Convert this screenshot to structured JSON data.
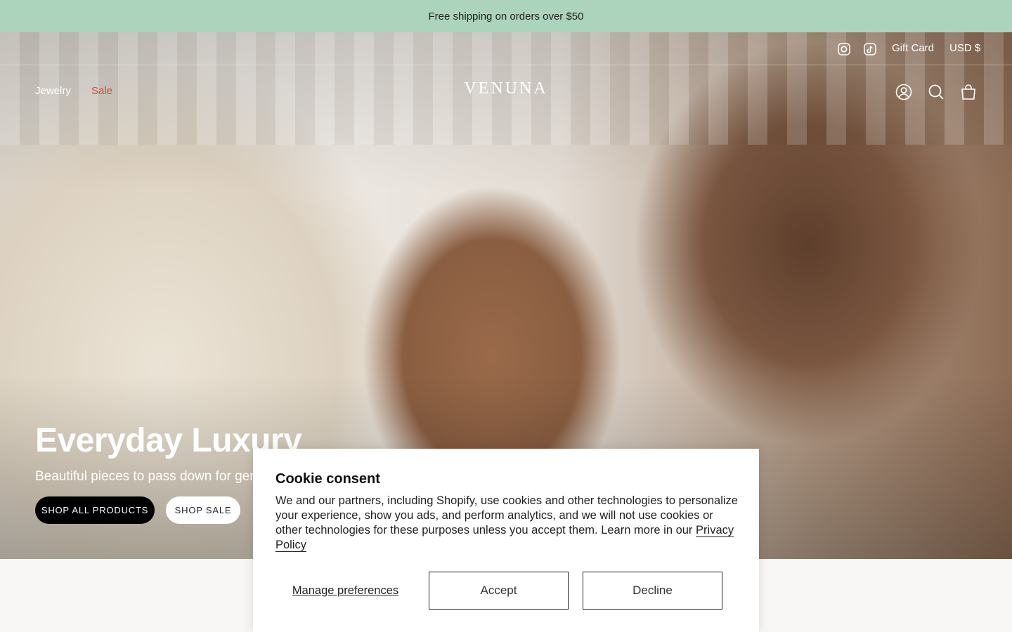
{
  "announcement": {
    "text": "Free shipping on orders over $50"
  },
  "utility": {
    "social": [
      {
        "icon": "instagram-icon"
      },
      {
        "icon": "tiktok-icon"
      }
    ],
    "gift_card": "Gift Card",
    "currency": "USD $"
  },
  "nav": {
    "items": [
      {
        "label": "Jewelry",
        "color": "#ffffff"
      },
      {
        "label": "Sale",
        "color": "#e0443a"
      }
    ]
  },
  "logo": {
    "text": "VENUNA"
  },
  "header_icons": [
    "account-icon",
    "search-icon",
    "cart-icon"
  ],
  "hero": {
    "title": "Everyday Luxury",
    "subtitle": "Beautiful pieces to pass down for gen",
    "primary_button": "SHOP ALL PRODUCTS",
    "secondary_button": "SHOP SALE"
  },
  "cookie": {
    "title": "Cookie consent",
    "body": "We and our partners, including Shopify, use cookies and other technologies to personalize your experience, show you ads, and perform analytics, and we will not use cookies or other technologies for these purposes unless you accept them. Learn more in our",
    "privacy_link": "Privacy Policy",
    "manage_label": "Manage preferences",
    "accept_label": "Accept",
    "decline_label": "Decline"
  },
  "colors": {
    "announcement_bg": "#acd3bc",
    "sale": "#e0443a",
    "dark_button": "#000000"
  }
}
